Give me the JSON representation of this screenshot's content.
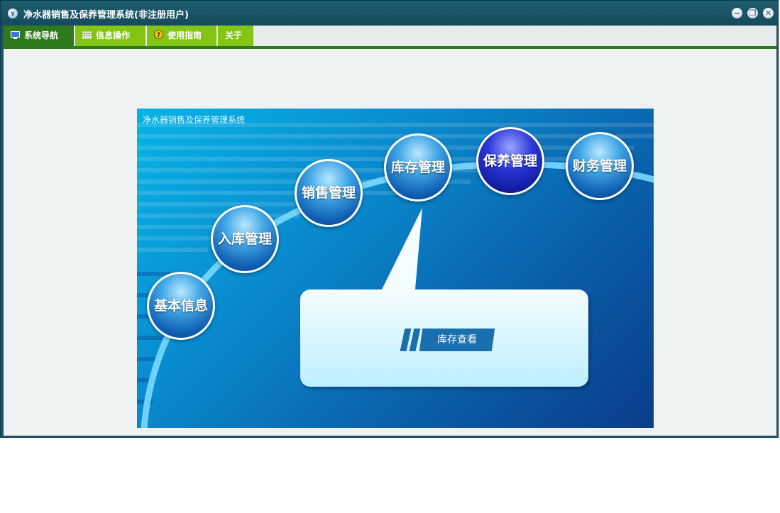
{
  "window": {
    "icon_letter": "y",
    "title": "净水器销售及保养管理系统(非注册用户)"
  },
  "window_controls": {
    "minimize_glyph": "−",
    "restore_glyph": "❐",
    "close_glyph": "✕"
  },
  "menu": {
    "items": [
      {
        "label": "系统导航",
        "icon": "monitor-icon"
      },
      {
        "label": "信息操作",
        "icon": "grid-icon"
      },
      {
        "label": "使用指南",
        "icon": "help-icon"
      },
      {
        "label": "关于",
        "icon": ""
      }
    ]
  },
  "banner": {
    "title": "净水器销售及保养管理系统",
    "nodes": [
      {
        "label": "基本信息"
      },
      {
        "label": "入库管理"
      },
      {
        "label": "销售管理"
      },
      {
        "label": "库存管理"
      },
      {
        "label": "保养管理",
        "selected": true
      },
      {
        "label": "财务管理"
      }
    ],
    "callout": {
      "action_label": "库存查看"
    }
  },
  "colors": {
    "titlebar": "#1d5566",
    "menu_green": "#84c414",
    "menu_active": "#2f7a1c",
    "banner_blue": "#0a8bcf",
    "selected_node": "#0f1a9c"
  }
}
